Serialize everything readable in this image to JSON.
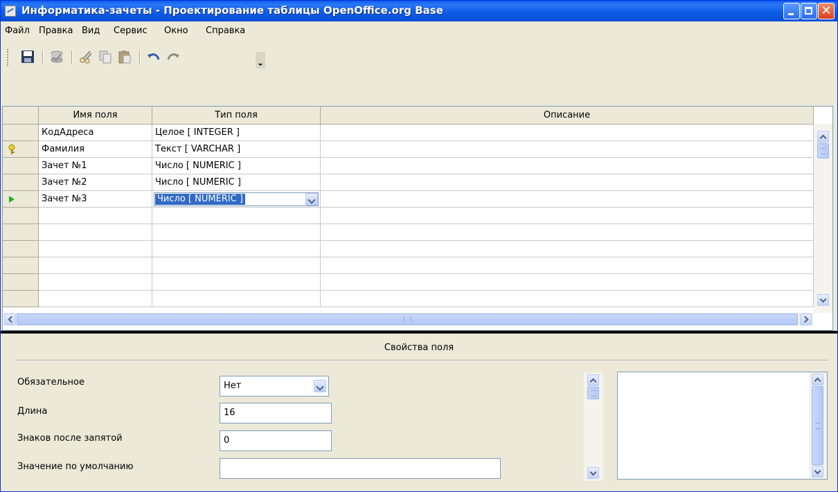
{
  "window": {
    "title": "Информатика-зачеты - Проектирование таблицы OpenOffice.org Base",
    "close_glyph": "✕"
  },
  "menu": [
    "Файл",
    "Правка",
    "Вид",
    "Сервис",
    "Окно",
    "Справка"
  ],
  "toolbar": {
    "icons": [
      "save-icon",
      "database-icon",
      "cut-icon",
      "copy-icon",
      "paste-icon",
      "undo-icon",
      "redo-icon"
    ]
  },
  "table": {
    "headers": [
      "Имя поля",
      "Тип поля",
      "Описание"
    ],
    "rows": [
      {
        "name": "КодАдреса",
        "type": "Целое [ INTEGER ]",
        "description": ""
      },
      {
        "name": "Фамилия",
        "type": "Текст [ VARCHAR ]",
        "description": ""
      },
      {
        "name": "Зачет №1",
        "type": "Число [ NUMERIC ]",
        "description": ""
      },
      {
        "name": "Зачет №2",
        "type": "Число [ NUMERIC ]",
        "description": ""
      },
      {
        "name": "Зачет №3",
        "type": "Число [ NUMERIC ]",
        "description": ""
      }
    ],
    "primary_key_row": 1,
    "current_row": 4,
    "scroll_grip": "|||"
  },
  "properties": {
    "title": "Свойства поля",
    "required": {
      "label": "Обязательное",
      "value": "Нет"
    },
    "length": {
      "label": "Длина",
      "value": "16"
    },
    "decimals": {
      "label": "Знаков после запятой",
      "value": "0"
    },
    "default_value": {
      "label": "Значение по умолчанию",
      "value": ""
    }
  },
  "colors": {
    "titlebar": "#0a5cf0",
    "selection": "#316ac5",
    "current_row_marker": "#1fb31f"
  }
}
